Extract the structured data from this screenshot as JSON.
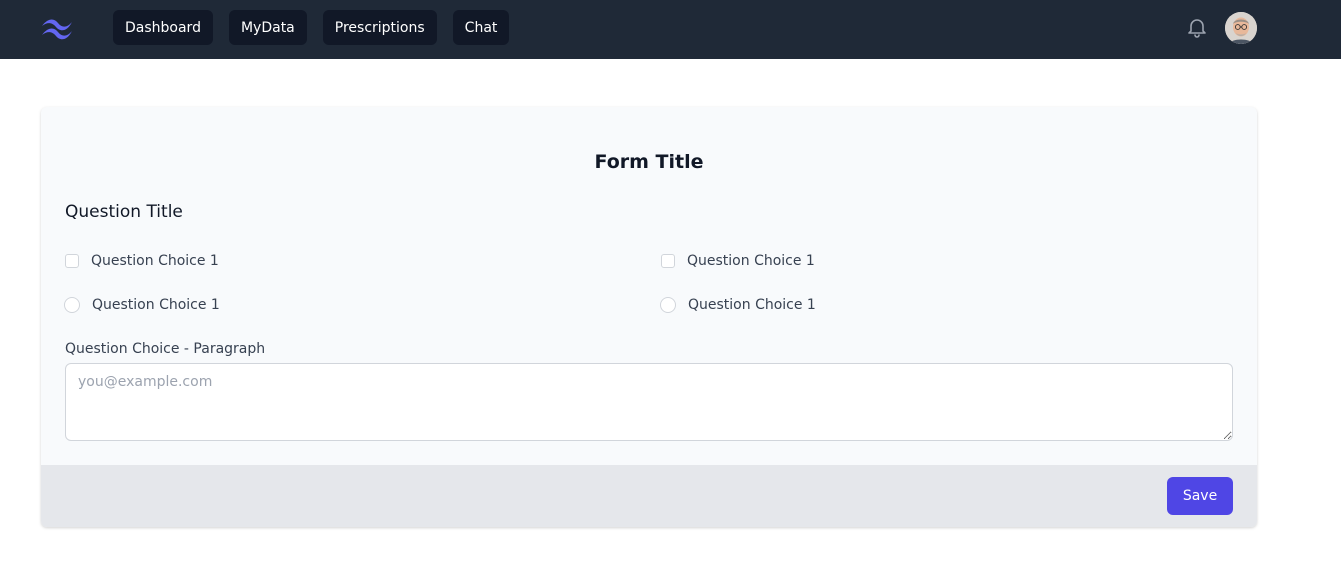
{
  "nav": {
    "logo_icon": "tailwind-wave-logo",
    "links": [
      {
        "label": "Dashboard"
      },
      {
        "label": "MyData"
      },
      {
        "label": "Prescriptions"
      },
      {
        "label": "Chat"
      }
    ],
    "notification_icon": "bell-icon",
    "avatar_icon": "user-avatar"
  },
  "form": {
    "title": "Form Title",
    "question_title": "Question Title",
    "checkbox_choices": [
      {
        "label": "Question Choice 1"
      },
      {
        "label": "Question Choice 1"
      }
    ],
    "radio_choices": [
      {
        "label": "Question Choice 1"
      },
      {
        "label": "Question Choice 1"
      }
    ],
    "paragraph_label": "Question Choice - Paragraph",
    "paragraph_placeholder": "you@example.com",
    "save_label": "Save"
  },
  "colors": {
    "nav_bg": "#1f2937",
    "nav_link_bg": "#111827",
    "card_bg": "#f8fafc",
    "footer_bg": "#e5e7eb",
    "accent": "#4f46e5",
    "logo": "#6366f1"
  }
}
